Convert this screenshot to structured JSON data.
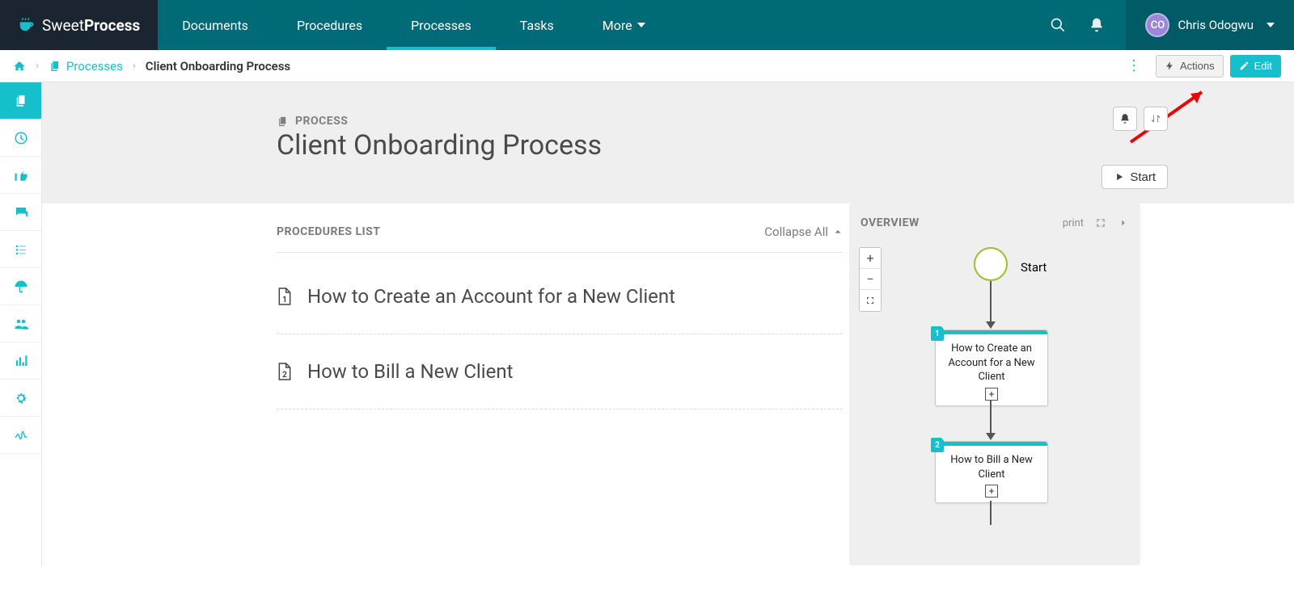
{
  "brand": {
    "part1": "Sweet",
    "part2": "Process"
  },
  "nav": {
    "documents": "Documents",
    "procedures": "Procedures",
    "processes": "Processes",
    "tasks": "Tasks",
    "more": "More"
  },
  "user": {
    "initials": "CO",
    "name": "Chris Odogwu"
  },
  "breadcrumb": {
    "processes": "Processes",
    "current": "Client Onboarding Process"
  },
  "actions": {
    "actions_label": "Actions",
    "edit_label": "Edit"
  },
  "hero": {
    "label": "PROCESS",
    "title": "Client Onboarding Process",
    "start": "Start"
  },
  "procedures_list": {
    "heading": "PROCEDURES LIST",
    "collapse": "Collapse All",
    "items": [
      {
        "num": "1",
        "title": "How to Create an Account for a New Client"
      },
      {
        "num": "2",
        "title": "How to Bill a New Client"
      }
    ]
  },
  "overview": {
    "heading": "OVERVIEW",
    "print": "print",
    "start_label": "Start",
    "nodes": [
      {
        "num": "1",
        "title": "How to Create an Account for a New Client"
      },
      {
        "num": "2",
        "title": "How to Bill a New Client"
      }
    ]
  },
  "zoom": {
    "in": "+",
    "out": "−"
  }
}
